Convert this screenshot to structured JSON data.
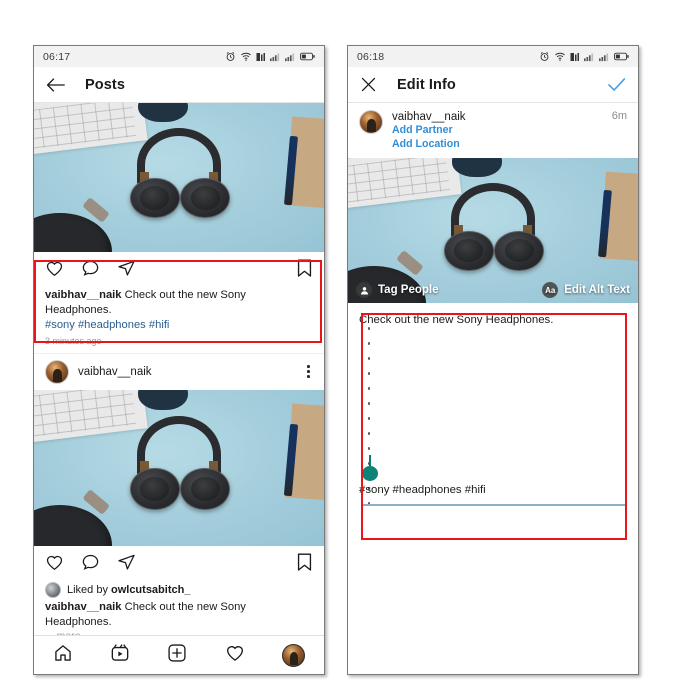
{
  "left_phone": {
    "status_bar": {
      "time": "06:17",
      "icons": [
        "alarm-icon",
        "wifi-icon",
        "mobile-data-icon",
        "signal-bars-icon-1",
        "signal-bars-icon-2",
        "battery-icon"
      ]
    },
    "header": {
      "back_icon": "back-arrow-icon",
      "title": "Posts"
    },
    "post1": {
      "image_alt": "black-sony-headphones-on-light-blue-desk",
      "actions": [
        "heart-icon",
        "comment-icon",
        "share-icon",
        "bookmark-icon"
      ],
      "username": "vaibhav__naik",
      "caption": "Check out the new Sony Headphones.",
      "hashtags": "#sony #headphones #hifi",
      "timestamp": "3 minutes ago"
    },
    "post2": {
      "avatar": "user-avatar",
      "username": "vaibhav__naik",
      "menu_icon": "more-options-icon",
      "image_alt": "black-sony-headphones-on-light-blue-desk",
      "actions": [
        "heart-icon",
        "comment-icon",
        "share-icon",
        "bookmark-icon"
      ],
      "liked_by_prefix": "Liked by",
      "liked_by_user": "owlcutsabitch_",
      "caption_user": "vaibhav__naik",
      "caption": "Check out the new Sony Headphones.",
      "more_label": "... more"
    },
    "bottom_nav": [
      {
        "name": "home-icon"
      },
      {
        "name": "reels-icon"
      },
      {
        "name": "create-post-icon"
      },
      {
        "name": "activity-heart-icon"
      },
      {
        "name": "profile-avatar-icon"
      }
    ]
  },
  "right_phone": {
    "status_bar": {
      "time": "06:18",
      "icons": [
        "alarm-icon",
        "wifi-icon",
        "mobile-data-icon",
        "signal-bars-icon-1",
        "signal-bars-icon-2",
        "battery-icon"
      ]
    },
    "header": {
      "close_icon": "close-x-icon",
      "title": "Edit Info",
      "confirm_icon": "checkmark-icon",
      "confirm_color": "#4a9fe0"
    },
    "user_row": {
      "avatar": "user-avatar",
      "username": "vaibhav__naik",
      "add_partner": "Add Partner",
      "add_location": "Add Location",
      "time": "6m"
    },
    "photo_overlay": {
      "tag_people_icon": "person-tag-icon",
      "tag_people_label": "Tag People",
      "alt_text_icon": "Aa",
      "alt_text_label": "Edit Alt Text"
    },
    "caption_editor": {
      "text": "Check out the new Sony Headphones.",
      "hashtags": "#sony #headphones #hifi",
      "cursor_handle": "text-selection-handle",
      "handle_color": "#0d8276",
      "underline_color": "#8fb0c4"
    }
  },
  "annotations": {
    "highlight_color": "#e8161b",
    "boxes": [
      {
        "name": "left-caption-highlight"
      },
      {
        "name": "right-editor-highlight"
      }
    ]
  }
}
